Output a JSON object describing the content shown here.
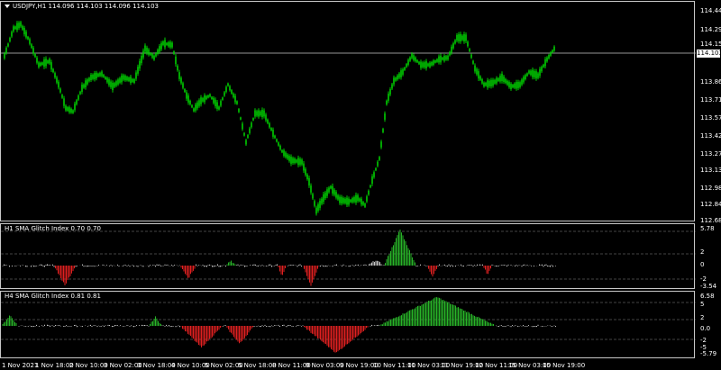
{
  "main": {
    "symbol_label": "USDJPY,H1",
    "ohlc_label": "114.096 114.103 114.096 114.103",
    "current_price": "114.103",
    "price_scale": [
      "114.445",
      "114.295",
      "114.150",
      "113.860",
      "113.715",
      "113.570",
      "113.425",
      "113.275",
      "113.130",
      "112.985",
      "112.840",
      "112.680"
    ]
  },
  "indicator1": {
    "title": "H1 SMA Glitch Index 0.70 0.70",
    "scale": [
      "5.78",
      "2",
      "0",
      "-2",
      "-3.54"
    ]
  },
  "indicator2": {
    "title": "H4 SMA Glitch Index 0.81 0.81",
    "scale": [
      "6.58",
      "5",
      "2",
      "0.0",
      "-2",
      "-5",
      "-5.79"
    ]
  },
  "time_axis": [
    "1 Nov 2021",
    "1 Nov 18:00",
    "2 Nov 10:00",
    "3 Nov 02:00",
    "3 Nov 18:00",
    "4 Nov 10:00",
    "5 Nov 02:00",
    "5 Nov 18:00",
    "8 Nov 11:00",
    "9 Nov 03:00",
    "9 Nov 19:00",
    "10 Nov 11:00",
    "11 Nov 03:00",
    "11 Nov 19:00",
    "12 Nov 11:00",
    "15 Nov 03:00",
    "15 Nov 19:00"
  ],
  "colors": {
    "candle_up": "#00d000",
    "candle_down": "#00d000",
    "osc_neutral": "#c8c8c8",
    "osc_positive": "#28b428",
    "osc_negative": "#e02020",
    "crosshair": "#c8c8c8"
  }
}
